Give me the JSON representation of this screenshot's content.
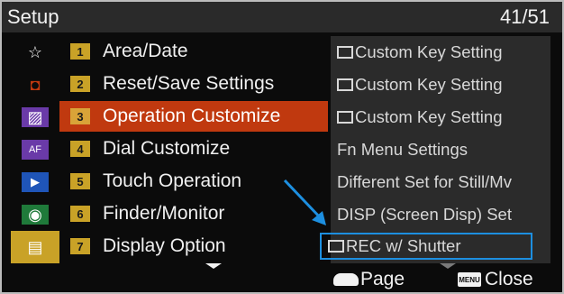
{
  "header": {
    "title": "Setup",
    "page_indicator": "41/51"
  },
  "categories": [
    {
      "icon": "star-icon",
      "glyph": "☆",
      "bg": ""
    },
    {
      "icon": "camera-icon",
      "glyph": "◘",
      "bg": ""
    },
    {
      "icon": "image-icon",
      "glyph": "▨",
      "bg": "#6a3aa8"
    },
    {
      "icon": "af-mf-icon",
      "glyph": "AF",
      "bg": "#6a3aa8"
    },
    {
      "icon": "playback-icon",
      "glyph": "▶",
      "bg": "#1f55b8"
    },
    {
      "icon": "network-icon",
      "glyph": "◉",
      "bg": "#1f7a3a"
    },
    {
      "icon": "toolbox-icon",
      "glyph": "▤",
      "bg": "#c9a227"
    }
  ],
  "menu": [
    {
      "num": "1",
      "label": "Area/Date"
    },
    {
      "num": "2",
      "label": "Reset/Save Settings"
    },
    {
      "num": "3",
      "label": "Operation Customize"
    },
    {
      "num": "4",
      "label": "Dial Customize"
    },
    {
      "num": "5",
      "label": "Touch Operation"
    },
    {
      "num": "6",
      "label": "Finder/Monitor"
    },
    {
      "num": "7",
      "label": "Display Option"
    }
  ],
  "submenu": [
    {
      "label": "Custom Key Setting",
      "icon": "photo-icon"
    },
    {
      "label": "Custom Key Setting",
      "icon": "movie-icon"
    },
    {
      "label": "Custom Key Setting",
      "icon": "playback-icon"
    },
    {
      "label": "Fn Menu Settings"
    },
    {
      "label": "Different Set for Still/Mv"
    },
    {
      "label": "DISP (Screen Disp) Set"
    },
    {
      "label": "REC w/ Shutter",
      "icon": "movie-icon"
    }
  ],
  "footer": {
    "page_label": "Page",
    "menu_icon_text": "MENU",
    "close_label": "Close"
  },
  "colors": {
    "selected": "#c0390f",
    "highlight": "#1d8fe0",
    "number_badge": "#c9a227"
  }
}
